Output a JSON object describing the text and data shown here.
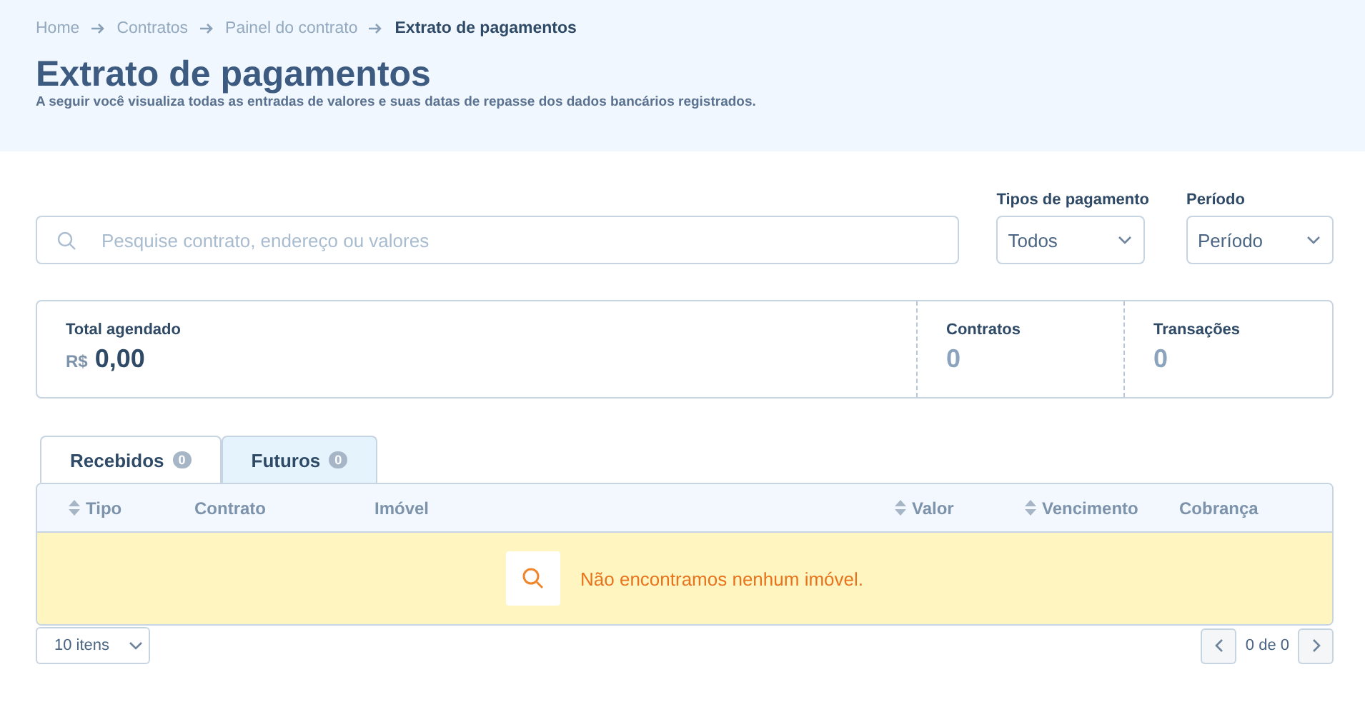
{
  "breadcrumb": [
    {
      "label": "Home",
      "current": false
    },
    {
      "label": "Contratos",
      "current": false
    },
    {
      "label": "Painel do contrato",
      "current": false
    },
    {
      "label": "Extrato de pagamentos",
      "current": true
    }
  ],
  "title": "Extrato de pagamentos",
  "subtitle": "A seguir você visualiza todas as entradas de valores e suas datas de repasse dos dados bancários registrados.",
  "search": {
    "placeholder": "Pesquise contrato, endereço ou valores"
  },
  "filters": [
    {
      "label": "Tipos de pagamento",
      "value": "Todos"
    },
    {
      "label": "Período",
      "value": "Período"
    }
  ],
  "summary": {
    "total_label": "Total agendado",
    "currency": "R$",
    "total": "0,00",
    "stats": [
      {
        "label": "Contratos",
        "value": "0"
      },
      {
        "label": "Transações",
        "value": "0"
      }
    ]
  },
  "tabs": [
    {
      "label": "Recebidos",
      "count": "0",
      "selected": true
    },
    {
      "label": "Futuros",
      "count": "0",
      "selected": false
    }
  ],
  "table": {
    "columns": [
      {
        "label": "Tipo",
        "sortable": true
      },
      {
        "label": "Contrato",
        "sortable": false
      },
      {
        "label": "Imóvel",
        "sortable": false
      },
      {
        "label": "Valor",
        "sortable": true
      },
      {
        "label": "Vencimento",
        "sortable": true
      },
      {
        "label": "Cobrança",
        "sortable": false
      }
    ],
    "empty_message": "Não encontramos nenhum imóvel."
  },
  "pagination": {
    "page_size": "10 itens",
    "range": "0 de 0"
  }
}
